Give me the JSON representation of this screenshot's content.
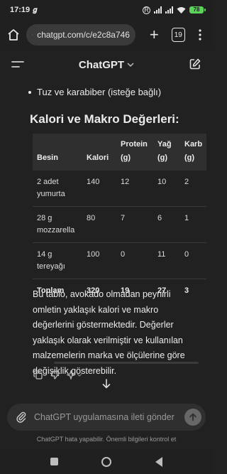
{
  "status": {
    "time": "17:19",
    "battery": "78"
  },
  "browser": {
    "url": "chatgpt.com/c/e2c8a746",
    "tab_count": "19"
  },
  "header": {
    "title": "ChatGPT"
  },
  "content": {
    "bullet_text": "Tuz ve karabiber (isteğe bağlı)",
    "section_title": "Kalori ve Makro Değerleri:",
    "table": {
      "headers": [
        "Besin",
        "Kalori",
        "Protein (g)",
        "Yağ (g)",
        "Karb (g)"
      ],
      "rows": [
        [
          "2 adet yumurta",
          "140",
          "12",
          "10",
          "2"
        ],
        [
          "28 g mozzarella",
          "80",
          "7",
          "6",
          "1"
        ],
        [
          "14 g tereyağı",
          "100",
          "0",
          "11",
          "0"
        ]
      ],
      "total": [
        "Toplam",
        "320",
        "19",
        "27",
        "3"
      ]
    },
    "paragraph": "Bu tablo, avokado olmadan peynirli omletin yaklaşık kalori ve makro değerlerini göstermektedir. Değerler yaklaşık olarak verilmiştir ve kullanılan malzemelerin marka ve ölçülerine göre değişiklik gösterebilir."
  },
  "input": {
    "placeholder": "ChatGPT uygulamasına ileti gönder"
  },
  "disclaimer": "ChatGPT hata yapabilir. Önemli bilgileri kontrol et",
  "icons": [
    "home-icon",
    "site-settings-icon",
    "plus-icon",
    "tabs-icon",
    "menu-icon",
    "hamburger-icon",
    "chevron-down-icon",
    "edit-icon",
    "copy-icon",
    "thumbs-down-icon",
    "sparkle-icon",
    "arrow-down-icon",
    "attach-icon",
    "send-icon"
  ],
  "colors": {
    "background": "#212121",
    "surface": "#2f2f2f",
    "text": "#ececec",
    "battery": "#5bd35b"
  }
}
